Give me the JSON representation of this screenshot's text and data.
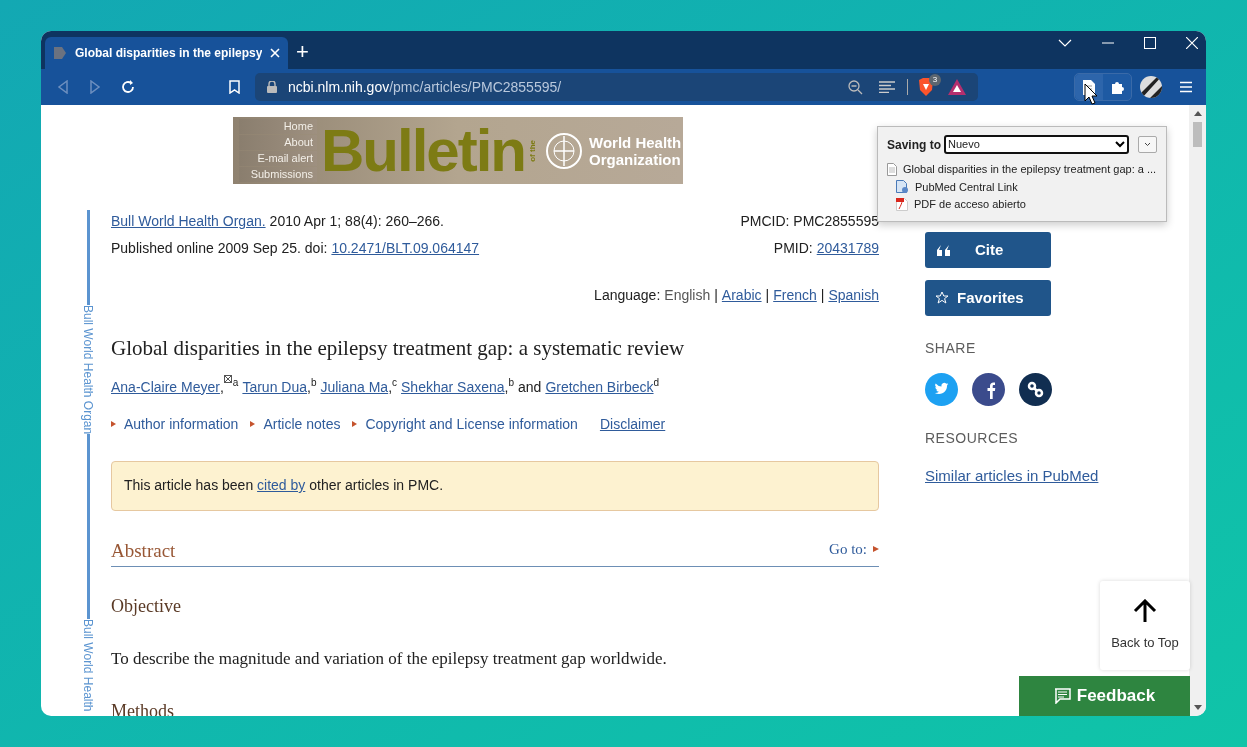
{
  "browser": {
    "tab_title": "Global disparities in the epilepsy",
    "new_tab": "+",
    "url_host": "ncbi.nlm.nih.gov",
    "url_path": "/pmc/articles/PMC2855595/",
    "shield_count": "3"
  },
  "popup": {
    "label": "Saving to",
    "select_value": "Nuevo",
    "items": [
      {
        "kind": "page",
        "text": "Global disparities in the epilepsy treatment gap: a ...",
        "children": [
          {
            "kind": "link",
            "text": "PubMed Central Link"
          },
          {
            "kind": "pdf",
            "text": "PDF de acceso abierto"
          }
        ]
      }
    ]
  },
  "banner": {
    "nav": [
      "Home",
      "About",
      "E-mail alert",
      "Submissions"
    ],
    "title": "Bulletin",
    "of_the": "of the",
    "org": [
      "World Health",
      "Organization"
    ]
  },
  "side_labels": [
    "Bull World Health Organ",
    "Bull World Health"
  ],
  "citation": {
    "journal": "Bull World Health Organ.",
    "details": "2010 Apr 1; 88(4): 260–266.",
    "published": "Published online 2009 Sep 25. doi:",
    "doi": "10.2471/BLT.09.064147",
    "pmcid": "PMCID: PMC2855595",
    "pmid_label": "PMID:",
    "pmid": "20431789"
  },
  "language": {
    "label": "Language:",
    "separator": "|",
    "items": [
      {
        "text": "English",
        "selected": true
      },
      {
        "text": "Arabic",
        "selected": false
      },
      {
        "text": "French",
        "selected": false
      },
      {
        "text": "Spanish",
        "selected": false
      }
    ]
  },
  "title": "Global disparities in the epilepsy treatment gap: a systematic review",
  "authors": {
    "conjunction": "and",
    "comma": ",",
    "items": [
      {
        "name": "Ana-Claire Meyer",
        "email": true,
        "sup": "a"
      },
      {
        "name": "Tarun Dua",
        "email": false,
        "sup": "b"
      },
      {
        "name": "Juliana Ma",
        "email": false,
        "sup": "c"
      },
      {
        "name": "Shekhar Saxena",
        "email": false,
        "sup": "b"
      },
      {
        "name": "Gretchen Birbeck",
        "email": false,
        "sup": "d"
      }
    ]
  },
  "info_links": [
    "Author information",
    "Article notes",
    "Copyright and License information"
  ],
  "disclaimer": "Disclaimer",
  "notice": {
    "before": "This article has been",
    "link": "cited by",
    "after": "other articles in PMC."
  },
  "abstract": {
    "heading": "Abstract",
    "goto": "Go to:",
    "sections": [
      {
        "kind": "heading",
        "text": "Objective"
      },
      {
        "kind": "paragraph",
        "text": "To describe the magnitude and variation of the epilepsy treatment gap worldwide."
      },
      {
        "kind": "heading",
        "text": "Methods"
      }
    ]
  },
  "sidebar": {
    "buttons": [
      {
        "kind": "cite",
        "label": "Cite"
      },
      {
        "kind": "favorites",
        "label": "Favorites"
      }
    ],
    "share_heading": "SHARE",
    "share": [
      {
        "kind": "twitter",
        "color": "#1da1f2"
      },
      {
        "kind": "facebook",
        "color": "#3b4b8c"
      },
      {
        "kind": "link",
        "color": "#112e51"
      }
    ],
    "resources_heading": "RESOURCES",
    "resources": [
      "Similar articles in PubMed"
    ]
  },
  "back_to_top": "Back to Top",
  "feedback": "Feedback"
}
